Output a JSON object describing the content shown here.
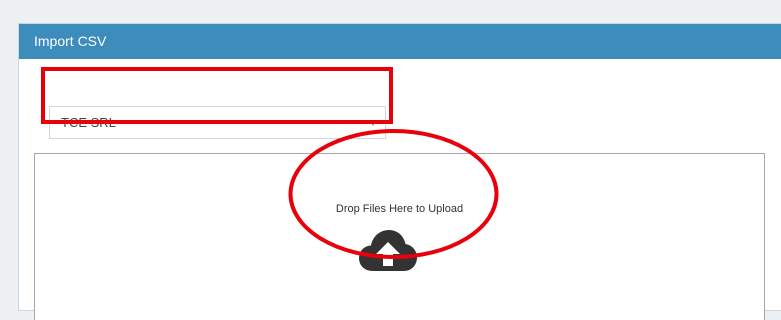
{
  "panel": {
    "title": "Import CSV"
  },
  "company_select": {
    "selected": "TCE SRL",
    "caret_icon": "caret-down-icon"
  },
  "dropzone": {
    "message": "Drop Files Here to Upload",
    "icon": "cloud-upload-icon"
  },
  "annotations": {
    "color": "#e8000b"
  },
  "colors": {
    "header": "#3c8dbc",
    "background": "#eef1f4"
  }
}
